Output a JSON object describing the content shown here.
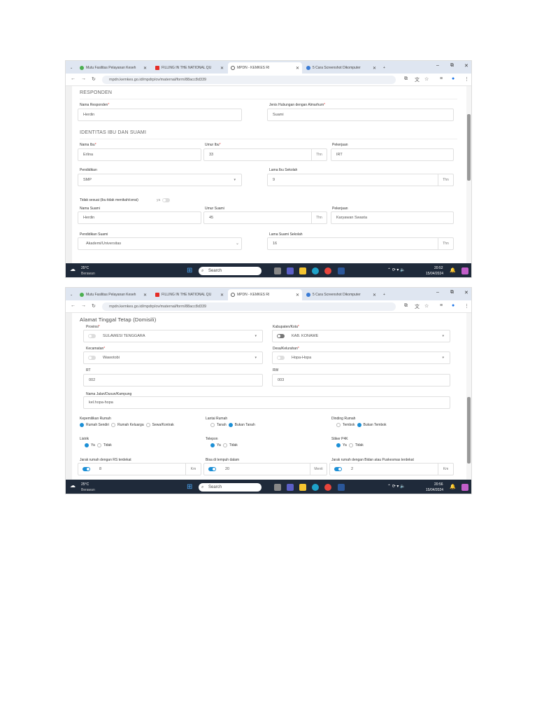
{
  "browser": {
    "tabs": [
      "Mutu Fasilitas Pelayanan Keseh",
      "FILLING IN THE NATIONAL QU",
      "MPDN - KEMKES RI",
      "5 Cara Screenshot Dikomputer"
    ],
    "url": "mpdn.kemkes.go.id/mpdrp/ov/maternal/form/88acc8d339"
  },
  "taskbar": {
    "weather_temp": "25°C",
    "weather_desc": "Berawan",
    "search_label": "Search",
    "date": "15/04/2024",
    "time1": "20:52",
    "time2": "20:56"
  },
  "shot1": {
    "responden_title": "RESPONDEN",
    "nama_responden_label": "Nama Responden",
    "nama_responden": "Herdin",
    "hubungan_label": "Jenis Hubungan dengan Almarhum",
    "hubungan": "Suami",
    "identitas_title": "IDENTITAS IBU DAN SUAMI",
    "nama_ibu_label": "Nama Ibu",
    "nama_ibu": "Erlina",
    "umur_ibu_label": "Umur Ibu",
    "umur_ibu": "33",
    "unit_thn": "Thn",
    "pekerjaan_label": "Pekerjaan",
    "pekerjaan_ibu": "IRT",
    "pendidikan_label": "Pendidikan",
    "pendidikan": "SMP",
    "lama_ibu_label": "Lama Ibu Sekolah",
    "lama_ibu": "9",
    "tidak_sesuai_label": "Tidak sesuai (ibu tidak menikah/cerai)",
    "tidak_sesuai_toggle": "ya",
    "nama_suami_label": "Nama Suami",
    "nama_suami": "Herdin",
    "umur_suami_label": "Umur Suami",
    "umur_suami": "45",
    "pekerjaan_suami": "Karyawan Swasta",
    "pendidikan_suami_label": "Pendidikan Suami",
    "pendidikan_suami": "Akademi/Universitas",
    "lama_suami_label": "Lama Suami Sekolah",
    "lama_suami": "16"
  },
  "shot2": {
    "alamat_title": "Alamat Tinggal Tetap (Domisili)",
    "provinsi_label": "Provinsi",
    "provinsi": "SULAWESI TENGGARA",
    "kabupaten_label": "Kabupaten/Kota",
    "kabupaten": "KAB. KONAWE",
    "kecamatan_label": "Kecamatan",
    "kecamatan": "Wawotobi",
    "desa_label": "Desa/Kelurahan",
    "desa": "Hopa-Hopa",
    "rt_label": "RT",
    "rt": "002",
    "rw_label": "RW",
    "rw": "003",
    "jalan_label": "Nama Jalan/Dusun/Kampung",
    "jalan": "kel.hopa-hopa",
    "kepemilikan_label": "Kepemilikan Rumah",
    "kepemilikan_options": [
      "Rumah Sendiri",
      "Rumah Keluarga",
      "Sewa/Kontrak"
    ],
    "lantai_label": "Lantai Rumah",
    "lantai_options": [
      "Tanah",
      "Bukan Tanah"
    ],
    "dinding_label": "Dinding Rumah",
    "dinding_options": [
      "Tembok",
      "Bukan Tembok"
    ],
    "listrik_label": "Listrik",
    "telepon_label": "Telepon",
    "stiker_label": "Stiker P4K",
    "ya": "Ya",
    "tidak": "Tidak",
    "jarak_rs_label": "Jarak rumah dengan RS terdekat",
    "jarak_rs": "8",
    "unit_km": "Km",
    "tempuh_label": "Bisa di tempuh dalam",
    "tempuh": "20",
    "unit_menit": "Menit",
    "jarak_bidan_label": "Jarak rumah dengan Bidan atau Puskesmas terdekat",
    "jarak_bidan": "2"
  }
}
